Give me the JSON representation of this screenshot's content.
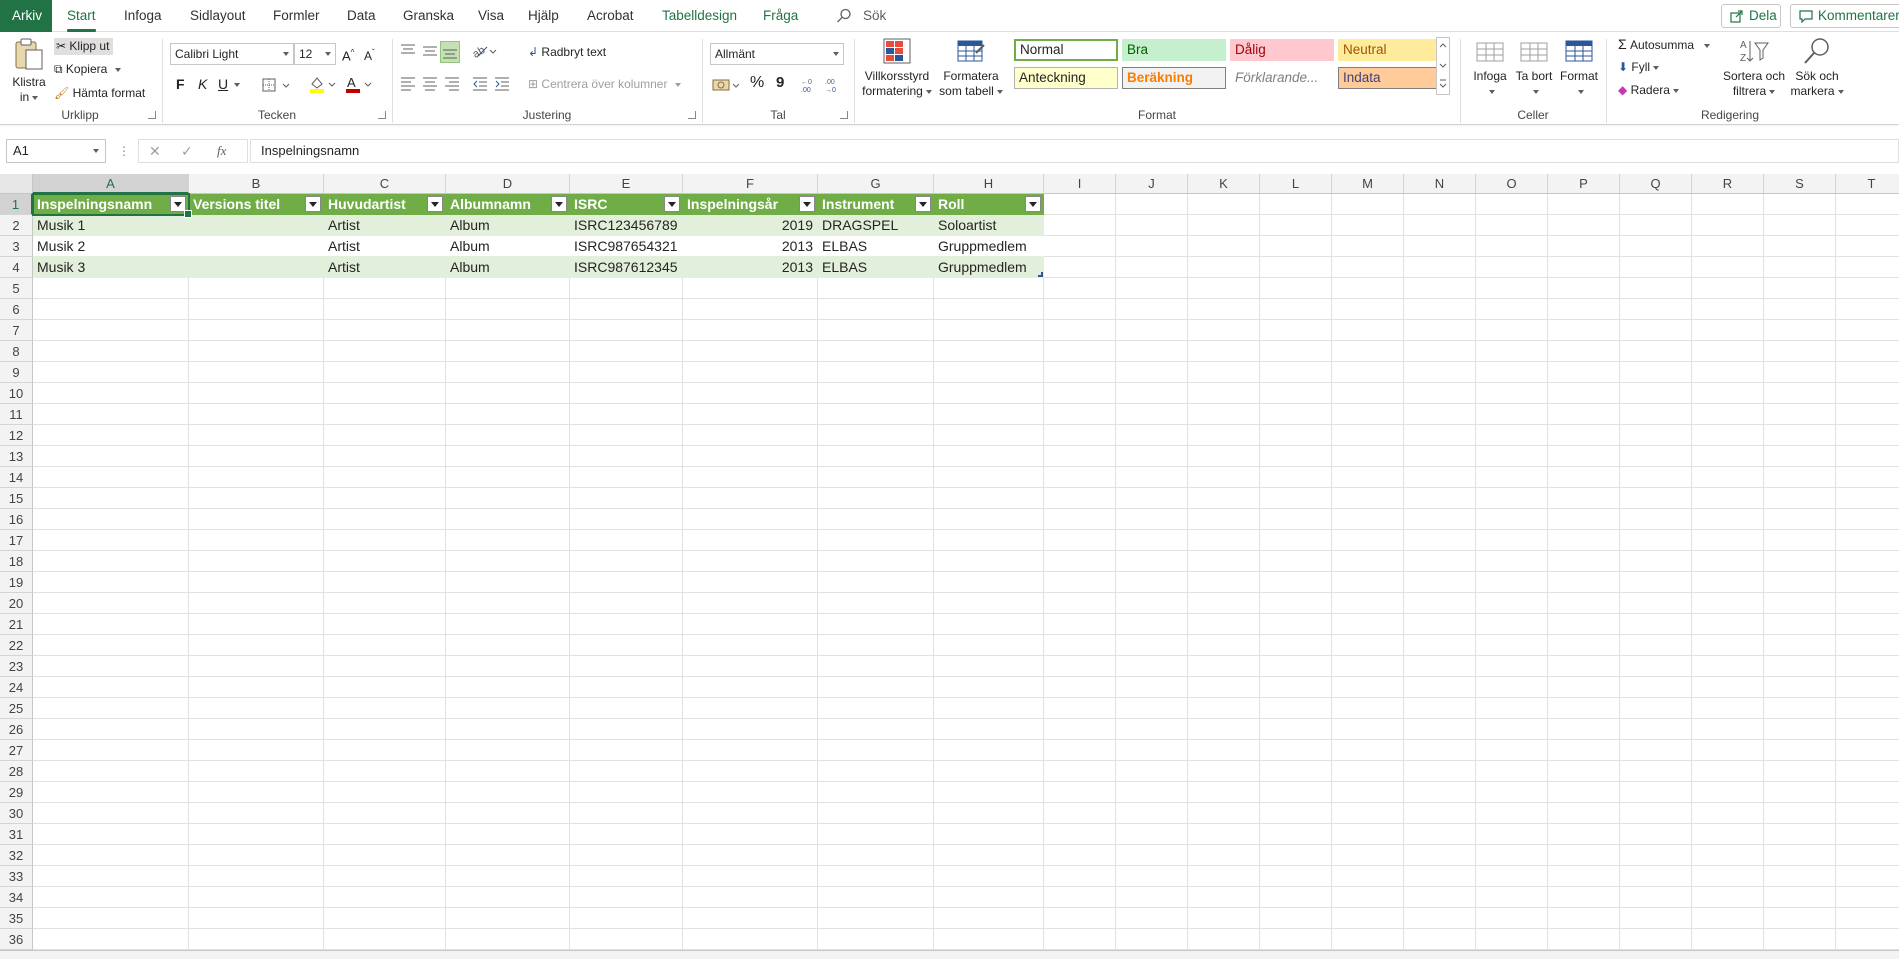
{
  "menubar": {
    "file": "Arkiv",
    "tabs": [
      "Start",
      "Infoga",
      "Sidlayout",
      "Formler",
      "Data",
      "Granska",
      "Visa",
      "Hjälp",
      "Acrobat",
      "Tabelldesign",
      "Fråga"
    ],
    "search": "Sök",
    "share": "Dela",
    "comments": "Kommentarer"
  },
  "ribbon": {
    "clipboard": {
      "paste": "Klistra",
      "paste2": "in",
      "cut": "Klipp ut",
      "copy": "Kopiera",
      "format_painter": "Hämta format",
      "label": "Urklipp"
    },
    "font": {
      "name": "Calibri Light",
      "size": "12",
      "bold": "F",
      "italic": "K",
      "underline": "U",
      "label": "Tecken"
    },
    "alignment": {
      "wrap": "Radbryt text",
      "merge": "Centrera över kolumner",
      "label": "Justering"
    },
    "number": {
      "format": "Allmänt",
      "percent": "%",
      "comma": "9",
      "label": "Tal"
    },
    "styles": {
      "conditional": "Villkorsstyrd",
      "conditional2": "formatering",
      "as_table": "Formatera",
      "as_table2": "som tabell",
      "cells": [
        {
          "label": "Normal",
          "bg": "#ffffff",
          "fg": "#252423",
          "border": "#70ad47"
        },
        {
          "label": "Bra",
          "bg": "#c6efce",
          "fg": "#006100",
          "border": "#c6efce"
        },
        {
          "label": "Dålig",
          "bg": "#ffc7ce",
          "fg": "#9c0006",
          "border": "#ffc7ce"
        },
        {
          "label": "Neutral",
          "bg": "#ffeb9c",
          "fg": "#9c5700",
          "border": "#ffeb9c"
        },
        {
          "label": "Anteckning",
          "bg": "#ffffcc",
          "fg": "#252423",
          "border": "#b2b2b2"
        },
        {
          "label": "Beräkning",
          "bg": "#f2f2f2",
          "fg": "#fa7d00",
          "border": "#7f7f7f"
        },
        {
          "label": "Förklarande...",
          "bg": "#ffffff",
          "fg": "#7f7f7f",
          "border": "#ffffff"
        },
        {
          "label": "Indata",
          "bg": "#ffcc99",
          "fg": "#3f3f76",
          "border": "#7f7f7f"
        }
      ],
      "label": "Format"
    },
    "cells": {
      "insert": "Infoga",
      "delete": "Ta bort",
      "format": "Format",
      "label": "Celler"
    },
    "editing": {
      "autosum": "Autosumma",
      "fill": "Fyll",
      "clear": "Radera",
      "sort": "Sortera och",
      "sort2": "filtrera",
      "find": "Sök och",
      "find2": "markera",
      "label": "Redigering"
    }
  },
  "formula_bar": {
    "name_box": "A1",
    "fx": "fx",
    "content": "Inspelningsnamn"
  },
  "sheet": {
    "columns": [
      "A",
      "B",
      "C",
      "D",
      "E",
      "F",
      "G",
      "H",
      "I",
      "J",
      "K",
      "L",
      "M",
      "N",
      "O",
      "P",
      "Q",
      "R",
      "S",
      "T"
    ],
    "rows": [
      "1",
      "2",
      "3",
      "4",
      "5",
      "6",
      "7",
      "8",
      "9",
      "10",
      "11",
      "12",
      "13",
      "14",
      "15",
      "16",
      "17",
      "18",
      "19",
      "20",
      "21",
      "22",
      "23",
      "24",
      "25",
      "26",
      "27",
      "28",
      "29",
      "30",
      "31",
      "32",
      "33",
      "34",
      "35",
      "36"
    ],
    "table_headers": [
      "Inspelningsnamn",
      "Versions titel",
      "Huvudartist",
      "Albumnamn",
      "ISRC",
      "Inspelningsår",
      "Instrument",
      "Roll"
    ],
    "table_rows": [
      [
        "Musik 1",
        "",
        "Artist",
        "Album",
        "ISRC123456789",
        "2019",
        "DRAGSPEL",
        "Soloartist"
      ],
      [
        "Musik 2",
        "",
        "Artist",
        "Album",
        "ISRC987654321",
        "2013",
        "ELBAS",
        "Gruppmedlem"
      ],
      [
        "Musik 3",
        "",
        "Artist",
        "Album",
        "ISRC987612345",
        "2013",
        "ELBAS",
        "Gruppmedlem"
      ]
    ]
  },
  "colors": {
    "accent": "#217346",
    "table_header": "#70ad47",
    "table_band": "#e2efda"
  }
}
